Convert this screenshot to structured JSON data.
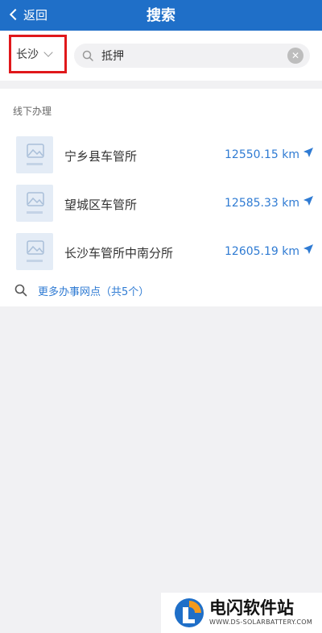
{
  "header": {
    "back_label": "返回",
    "title": "搜索"
  },
  "search": {
    "city": "长沙",
    "query": "抵押"
  },
  "results": {
    "section_title": "线下办理",
    "items": [
      {
        "name": "宁乡县车管所",
        "distance": "12550.15 km"
      },
      {
        "name": "望城区车管所",
        "distance": "12585.33 km"
      },
      {
        "name": "长沙车管所中南分所",
        "distance": "12605.19 km"
      }
    ],
    "more_label": "更多办事网点（共5个）"
  },
  "watermark": {
    "name": "电闪软件站",
    "url": "WWW.DS-SOLARBATTERY.COM"
  },
  "colors": {
    "header_bg": "#1f6fc8",
    "link_blue": "#2f7bd3",
    "highlight_red": "#e0181b"
  },
  "icons": [
    "back-chevron-icon",
    "dropdown-chevron-icon",
    "search-icon",
    "clear-icon",
    "image-placeholder-icon",
    "navigate-arrow-icon"
  ]
}
